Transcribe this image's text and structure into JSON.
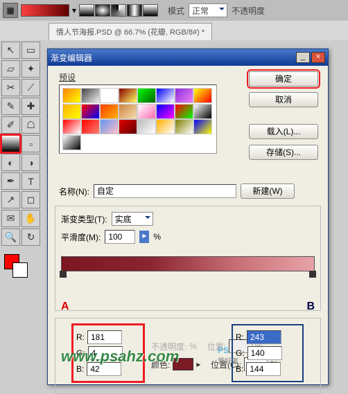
{
  "topbar": {
    "mode_label": "模式",
    "mode_value": "正常",
    "opacity_label": "不透明度"
  },
  "tab": {
    "title": "情人节海报.PSD @ 66.7% (花瓣, RGB/8#) *"
  },
  "dialog": {
    "title": "渐变编辑器",
    "presets_label": "预设",
    "buttons": {
      "ok": "确定",
      "cancel": "取消",
      "load": "载入(L)...",
      "save": "存储(S)..."
    },
    "name_label": "名称(N):",
    "name_value": "自定",
    "new_btn": "新建(W)",
    "grad_type_label": "渐变类型(T):",
    "grad_type_value": "实底",
    "smooth_label": "平滑度(M):",
    "smooth_value": "100",
    "smooth_pct": "%",
    "stops": {
      "A": "A",
      "B": "B"
    },
    "opacity_label": "不透明度:",
    "opacity_pct": "%",
    "pos_label": "位置:",
    "pos_label2": "位置(C):",
    "pos_pct": "%",
    "color_label": "颜色:",
    "rgbA": {
      "r_label": "R:",
      "g_label": "G:",
      "b_label": "B:",
      "r": "181",
      "g": "4",
      "b": "42"
    },
    "rgbB": {
      "r_label": "R:",
      "g_label": "G:",
      "b_label": "B:",
      "r": "243",
      "g": "140",
      "b": "144"
    }
  },
  "presets": [
    "#ff8000,#ffff00",
    "#444,#eee",
    "#fff,#fff",
    "#8b0000,#ff6",
    "#00ff00,#006400",
    "#0000ff,#fff",
    "#8a2be2,#ee82ee",
    "#ff0,#f00",
    "#ffb000,#ff0",
    "#ff0000,#0000ff",
    "#ff4000,#ffb000",
    "#cd853f,#f5deb3",
    "#fff,#ff69b4",
    "#00f,#f0f",
    "#f00,#0f0",
    "#fff,#000",
    "#f00,#fff",
    "#f00,#fa8072",
    "#6495ed,#ffc0cb",
    "#d00,#600",
    "#bbb,#fff",
    "#ffb000,#fff",
    "#808000,#fff",
    "#00f,#ff0",
    "#fff,#000"
  ],
  "watermark": {
    "w1": "www.psahz.com",
    "w2": "PS",
    "w2sub": "爱好者"
  }
}
